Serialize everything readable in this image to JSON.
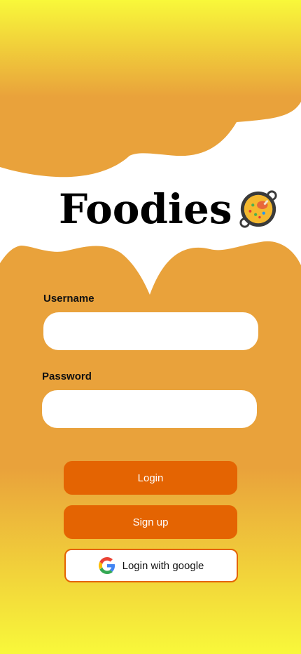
{
  "app": {
    "brand": "Foodies",
    "brand_icon": "paella-icon"
  },
  "form": {
    "username_label": "Username",
    "username_value": "",
    "password_label": "Password",
    "password_value": ""
  },
  "actions": {
    "login_label": "Login",
    "signup_label": "Sign up",
    "google_label": "Login with google",
    "google_icon": "google-icon"
  },
  "colors": {
    "gradient_yellow": "#F8F83A",
    "orange": "#E9A23B",
    "button_orange": "#E46402",
    "input_bg": "#FFFFFF"
  }
}
